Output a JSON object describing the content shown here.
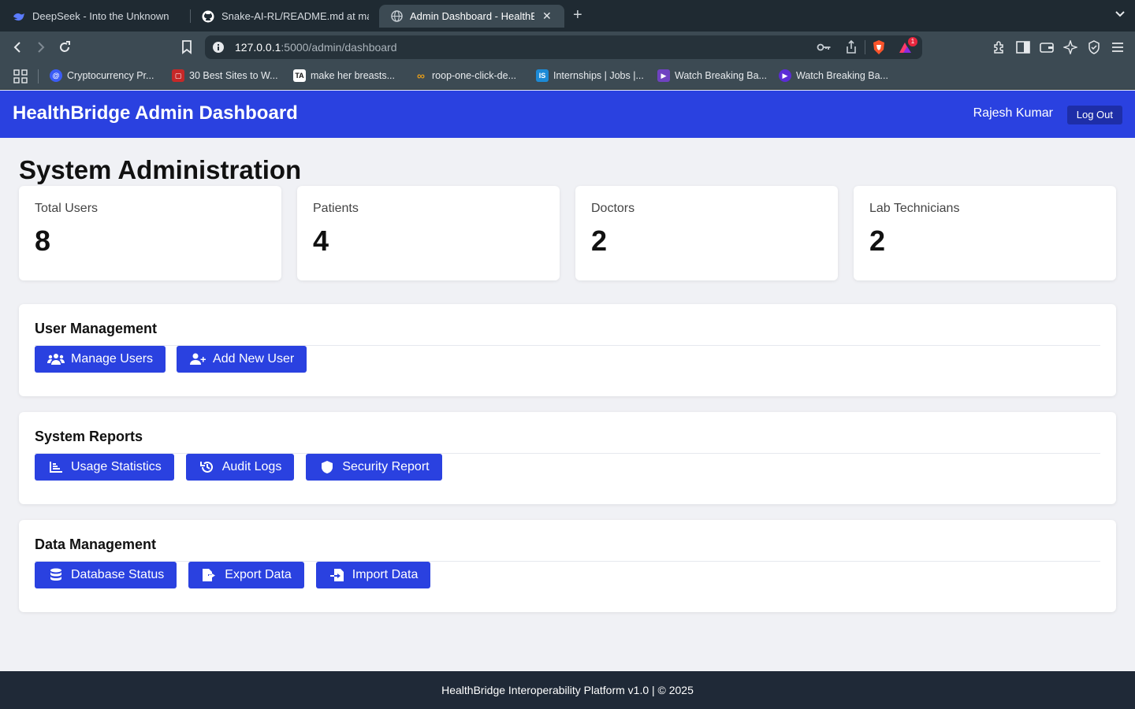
{
  "browser": {
    "tabs": [
      {
        "title": "DeepSeek - Into the Unknown",
        "icon": "deepseek-whale-icon"
      },
      {
        "title": "Snake-AI-RL/README.md at main",
        "icon": "github-icon"
      },
      {
        "title": "Admin Dashboard - HealthBridge",
        "icon": "globe-icon",
        "active": true
      }
    ],
    "url_host": "127.0.0.1",
    "url_path": ":5000/admin/dashboard",
    "brave_badge": "1",
    "bookmarks": [
      {
        "label": "Cryptocurrency Pr...",
        "icon": "crypto-icon",
        "color": "#3b5cf6"
      },
      {
        "label": "30 Best Sites to W...",
        "icon": "site-icon",
        "color": "#c62828"
      },
      {
        "label": "make her breasts...",
        "icon": "ta-icon",
        "text": "TA",
        "color": "#222222"
      },
      {
        "label": "roop-one-click-de...",
        "icon": "infinity-icon",
        "color": "#e39b1a"
      },
      {
        "label": "Internships | Jobs |...",
        "icon": "is-icon",
        "text": "IS",
        "color": "#1c8ad6"
      },
      {
        "label": "Watch Breaking Ba...",
        "icon": "film-icon",
        "color": "#6f42c1"
      },
      {
        "label": "Watch Breaking Ba...",
        "icon": "play-icon",
        "color": "#5b2bd6"
      }
    ]
  },
  "header": {
    "title": "HealthBridge Admin Dashboard",
    "user": "Rajesh Kumar",
    "logout_label": "Log Out"
  },
  "page_title": "System Administration",
  "stats": [
    {
      "label": "Total Users",
      "value": "8"
    },
    {
      "label": "Patients",
      "value": "4"
    },
    {
      "label": "Doctors",
      "value": "2"
    },
    {
      "label": "Lab Technicians",
      "value": "2"
    }
  ],
  "sections": [
    {
      "title": "User Management",
      "buttons": [
        {
          "label": "Manage Users",
          "icon": "users-icon"
        },
        {
          "label": "Add New User",
          "icon": "user-plus-icon"
        }
      ]
    },
    {
      "title": "System Reports",
      "buttons": [
        {
          "label": "Usage Statistics",
          "icon": "chart-icon"
        },
        {
          "label": "Audit Logs",
          "icon": "history-icon"
        },
        {
          "label": "Security Report",
          "icon": "shield-icon"
        }
      ]
    },
    {
      "title": "Data Management",
      "buttons": [
        {
          "label": "Database Status",
          "icon": "database-icon"
        },
        {
          "label": "Export Data",
          "icon": "file-export-icon"
        },
        {
          "label": "Import Data",
          "icon": "file-import-icon"
        }
      ]
    }
  ],
  "footer": "HealthBridge Interoperability Platform v1.0 | © 2025",
  "colors": {
    "primary": "#2a41e0",
    "footer": "#1f2937",
    "background": "#f0f1f5"
  }
}
